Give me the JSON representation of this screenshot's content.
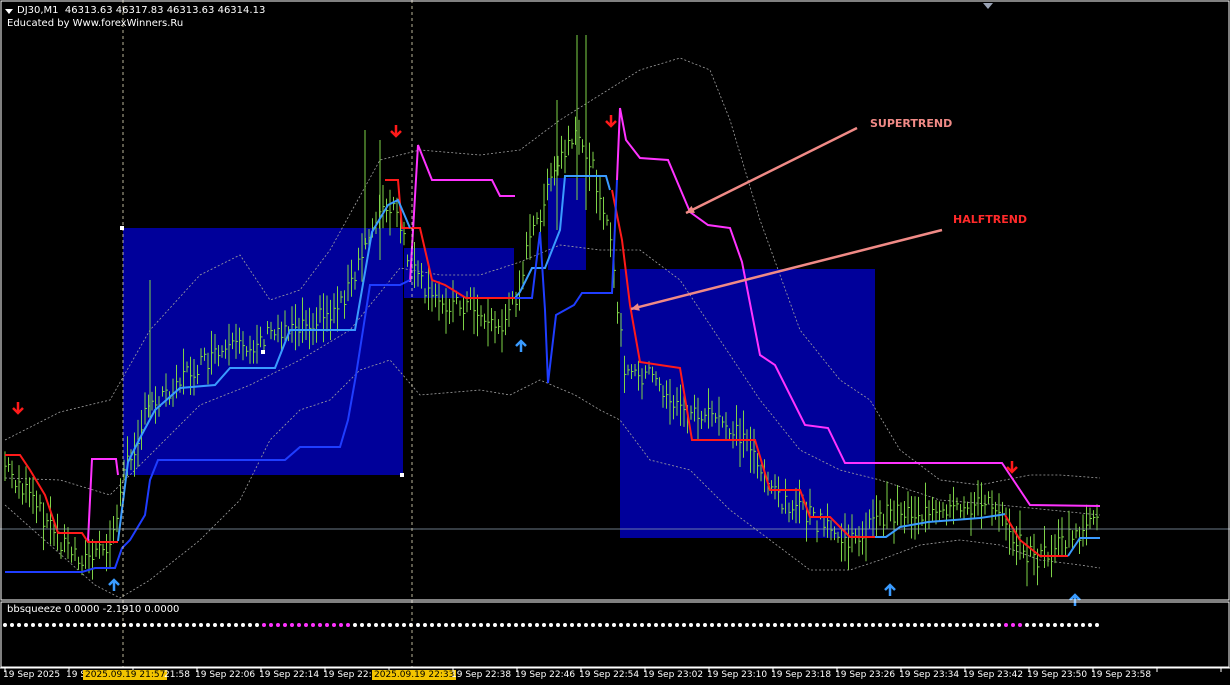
{
  "header": {
    "symbol": "DJ30,M1",
    "ohlc": "46313.63 46317.83 46313.63 46314.13",
    "credit": "Educated by Www.forexWinners.Ru"
  },
  "indicator": {
    "label": "bbsqueeze 0.0000 -2.1910 0.0000"
  },
  "annotations": {
    "supertrend": "SUPERTREND",
    "halftrend": "HALFTREND"
  },
  "time_axis": {
    "labels": [
      "19 Sep 2025",
      "19 S",
      "21:58",
      "19 Sep 22:06",
      "19 Sep 22:14",
      "19 Sep 22:2",
      "19 Sep 22:38",
      "19 Sep 22:46",
      "19 Sep 22:54",
      "19 Sep 23:02",
      "19 Sep 23:10",
      "19 Sep 23:18",
      "19 Sep 23:26",
      "19 Sep 23:34",
      "19 Sep 23:42",
      "19 Sep 23:50",
      "19 Sep 23:58"
    ],
    "cursor_labels": [
      "2025.09.19 21:57",
      "2025.09.19 22:33"
    ]
  },
  "colors": {
    "background": "#000000",
    "bars": "#7ed348",
    "supertrend_bear": "#ff33ff",
    "halftrend_bear": "#ff1a1a",
    "halftrend_bull": "#3a9bff",
    "supertrend_bull": "#1f3dff",
    "band": "#a0a0a0",
    "box": "#00009a",
    "arrow_down": "#ff1a1a",
    "arrow_up": "#3a9bff",
    "annotation_arrow": "#f08a86",
    "squeeze_on": "#ff33ff",
    "squeeze_off": "#ffffff",
    "cursor_tag": "#f2c400"
  },
  "icons": [
    "sell-arrow-icon",
    "buy-arrow-icon",
    "chart-menu-triangle-icon",
    "scroll-marker-icon"
  ]
}
